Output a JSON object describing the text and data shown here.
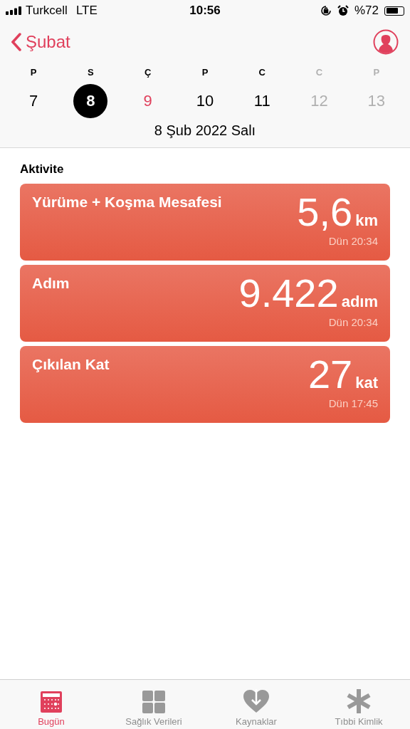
{
  "status_bar": {
    "carrier": "Turkcell",
    "network": "LTE",
    "time": "10:56",
    "battery_text": "%72"
  },
  "nav": {
    "back_label": "Şubat"
  },
  "week": [
    {
      "letter": "P",
      "day": "7",
      "selected": false,
      "today": false,
      "disabled": false
    },
    {
      "letter": "S",
      "day": "8",
      "selected": true,
      "today": false,
      "disabled": false
    },
    {
      "letter": "Ç",
      "day": "9",
      "selected": false,
      "today": true,
      "disabled": false
    },
    {
      "letter": "P",
      "day": "10",
      "selected": false,
      "today": false,
      "disabled": false
    },
    {
      "letter": "C",
      "day": "11",
      "selected": false,
      "today": false,
      "disabled": false
    },
    {
      "letter": "C",
      "day": "12",
      "selected": false,
      "today": false,
      "disabled": true
    },
    {
      "letter": "P",
      "day": "13",
      "selected": false,
      "today": false,
      "disabled": true
    }
  ],
  "date_label": "8 Şub 2022 Salı",
  "section_title": "Aktivite",
  "cards": [
    {
      "title": "Yürüme + Koşma Mesafesi",
      "value": "5,6",
      "unit": "km",
      "time": "Dün 20:34"
    },
    {
      "title": "Adım",
      "value": "9.422",
      "unit": "adım",
      "time": "Dün 20:34"
    },
    {
      "title": "Çıkılan Kat",
      "value": "27",
      "unit": "kat",
      "time": "Dün 17:45"
    }
  ],
  "tabs": [
    {
      "kind": "calendar",
      "label": "Bugün",
      "selected": true
    },
    {
      "kind": "grid",
      "label": "Sağlık Verileri",
      "selected": false
    },
    {
      "kind": "heart",
      "label": "Kaynaklar",
      "selected": false
    },
    {
      "kind": "asterisk",
      "label": "Tıbbi Kimlik",
      "selected": false
    }
  ]
}
